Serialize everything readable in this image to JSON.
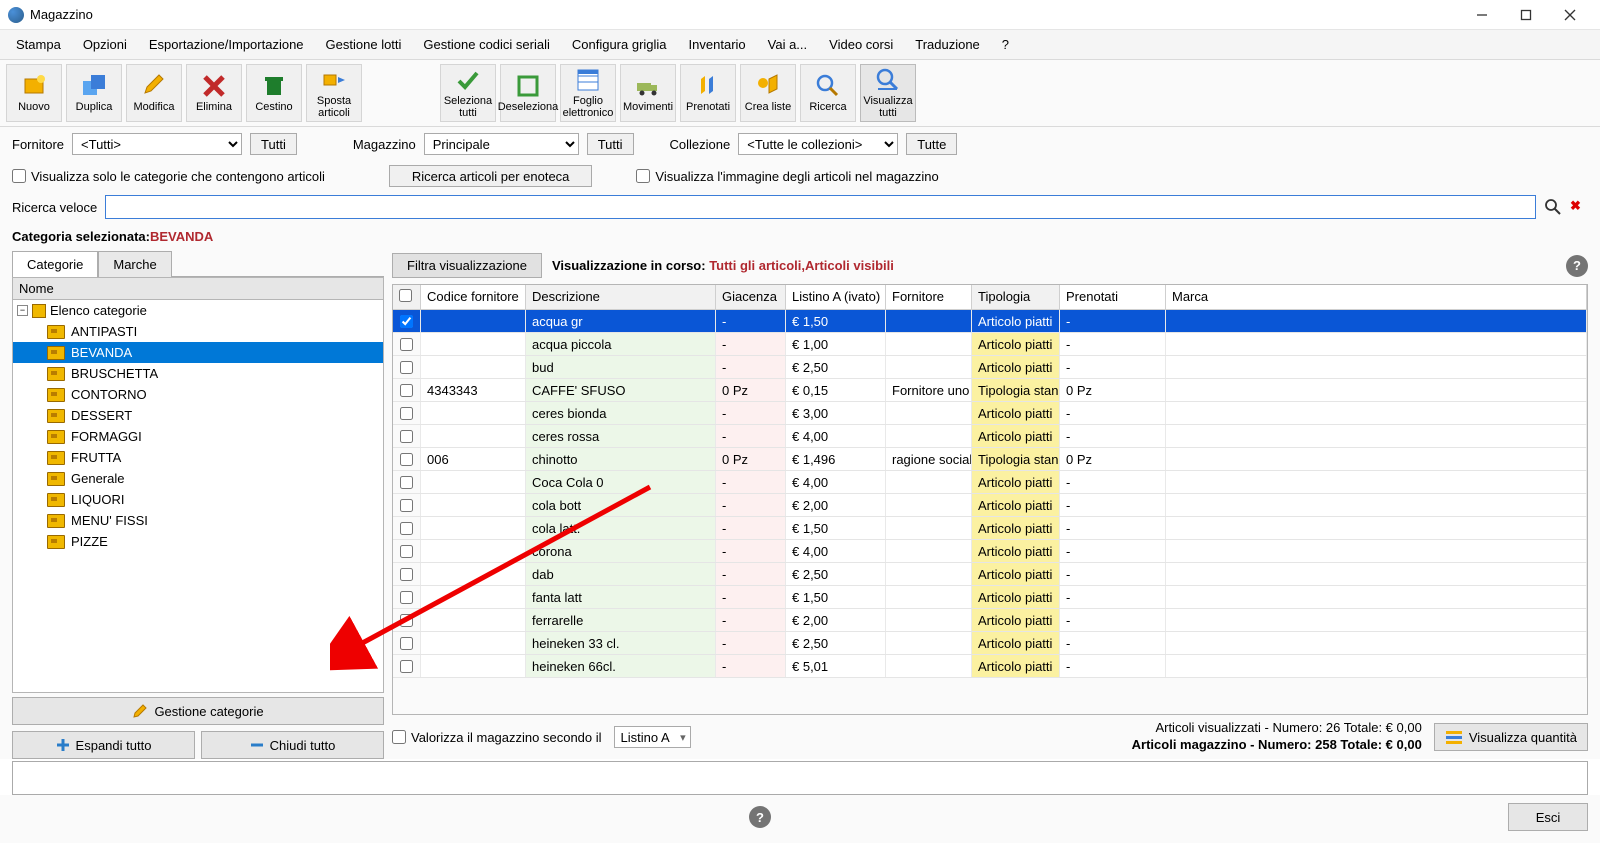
{
  "window": {
    "title": "Magazzino"
  },
  "menu": [
    "Stampa",
    "Opzioni",
    "Esportazione/Importazione",
    "Gestione lotti",
    "Gestione codici seriali",
    "Configura griglia",
    "Inventario",
    "Vai a...",
    "Video corsi",
    "Traduzione",
    "?"
  ],
  "toolbar": {
    "nuovo": "Nuovo",
    "duplica": "Duplica",
    "modifica": "Modifica",
    "elimina": "Elimina",
    "cestino": "Cestino",
    "sposta": "Sposta articoli",
    "sel_tutti": "Seleziona tutti",
    "deseleziona": "Deseleziona",
    "foglio": "Foglio elettronico",
    "movimenti": "Movimenti",
    "prenotati": "Prenotati",
    "crea_liste": "Crea liste",
    "ricerca": "Ricerca",
    "visualizza": "Visualizza tutti"
  },
  "filters": {
    "fornitore_lbl": "Fornitore",
    "fornitore_val": "<Tutti>",
    "tutti": "Tutti",
    "magazzino_lbl": "Magazzino",
    "magazzino_val": "Principale",
    "collezione_lbl": "Collezione",
    "collezione_val": "<Tutte le collezioni>",
    "tutte": "Tutte",
    "visualizza_solo": "Visualizza solo le categorie che contengono articoli",
    "ricerca_enoteca": "Ricerca articoli per enoteca",
    "visualizza_img": "Visualizza l'immagine degli articoli nel magazzino",
    "ricerca_veloce": "Ricerca veloce"
  },
  "category": {
    "sel_lbl": "Categoria selezionata: ",
    "sel_val": "BEVANDA",
    "tab_categorie": "Categorie",
    "tab_marche": "Marche",
    "nome": "Nome",
    "root": "Elenco categorie",
    "items": [
      "ANTIPASTI",
      "BEVANDA",
      "BRUSCHETTA",
      "CONTORNO",
      "DESSERT",
      "FORMAGGI",
      "FRUTTA",
      "Generale",
      "LIQUORI",
      "MENU' FISSI",
      "PIZZE"
    ],
    "gestione": "Gestione categorie",
    "espandi": "Espandi tutto",
    "chiudi": "Chiudi tutto"
  },
  "grid": {
    "filtra": "Filtra visualizzazione",
    "vis_corso": "Visualizzazione in corso: ",
    "vis_highlight": "Tutti gli articoli,Articoli visibili",
    "headers": {
      "codice": "Codice fornitore",
      "desc": "Descrizione",
      "giac": "Giacenza",
      "listino": "Listino A (ivato)",
      "forn": "Fornitore",
      "tipo": "Tipologia",
      "pren": "Prenotati",
      "marca": "Marca"
    },
    "rows": [
      {
        "sel": true,
        "cod": "",
        "desc": "acqua gr",
        "giac": "-",
        "list": "€ 1,50",
        "forn": "",
        "tipo": "Articolo piatti",
        "pren": "-"
      },
      {
        "cod": "",
        "desc": "acqua piccola",
        "giac": "-",
        "list": "€ 1,00",
        "forn": "",
        "tipo": "Articolo piatti",
        "pren": "-"
      },
      {
        "cod": "",
        "desc": "bud",
        "giac": "-",
        "list": "€ 2,50",
        "forn": "",
        "tipo": "Articolo piatti",
        "pren": "-"
      },
      {
        "cod": "4343343",
        "desc": "CAFFE' SFUSO",
        "giac": "0 Pz",
        "list": "€ 0,15",
        "forn": "Fornitore uno",
        "tipo": "Tipologia stan",
        "pren": "0 Pz"
      },
      {
        "cod": "",
        "desc": "ceres bionda",
        "giac": "-",
        "list": "€ 3,00",
        "forn": "",
        "tipo": "Articolo piatti",
        "pren": "-"
      },
      {
        "cod": "",
        "desc": "ceres rossa",
        "giac": "-",
        "list": "€ 4,00",
        "forn": "",
        "tipo": "Articolo piatti",
        "pren": "-"
      },
      {
        "cod": "006",
        "desc": "chinotto",
        "giac": "0 Pz",
        "list": "€ 1,496",
        "forn": "ragione sociale",
        "tipo": "Tipologia stan",
        "pren": "0 Pz"
      },
      {
        "cod": "",
        "desc": "Coca Cola 0",
        "giac": "-",
        "list": "€ 4,00",
        "forn": "",
        "tipo": "Articolo piatti",
        "pren": "-"
      },
      {
        "cod": "",
        "desc": "cola bott",
        "giac": "-",
        "list": "€ 2,00",
        "forn": "",
        "tipo": "Articolo piatti",
        "pren": "-"
      },
      {
        "cod": "",
        "desc": "cola latt.",
        "giac": "-",
        "list": "€ 1,50",
        "forn": "",
        "tipo": "Articolo piatti",
        "pren": "-"
      },
      {
        "cod": "",
        "desc": "corona",
        "giac": "-",
        "list": "€ 4,00",
        "forn": "",
        "tipo": "Articolo piatti",
        "pren": "-"
      },
      {
        "cod": "",
        "desc": "dab",
        "giac": "-",
        "list": "€ 2,50",
        "forn": "",
        "tipo": "Articolo piatti",
        "pren": "-"
      },
      {
        "cod": "",
        "desc": "fanta latt",
        "giac": "-",
        "list": "€ 1,50",
        "forn": "",
        "tipo": "Articolo piatti",
        "pren": "-"
      },
      {
        "cod": "",
        "desc": "ferrarelle",
        "giac": "-",
        "list": "€ 2,00",
        "forn": "",
        "tipo": "Articolo piatti",
        "pren": "-"
      },
      {
        "cod": "",
        "desc": "heineken 33 cl.",
        "giac": "-",
        "list": "€ 2,50",
        "forn": "",
        "tipo": "Articolo piatti",
        "pren": "-"
      },
      {
        "cod": "",
        "desc": "heineken 66cl.",
        "giac": "-",
        "list": "€ 5,01",
        "forn": "",
        "tipo": "Articolo piatti",
        "pren": "-"
      }
    ]
  },
  "footer": {
    "valorizza": "Valorizza il magazzino secondo il",
    "listino": "Listino A",
    "art_vis": "Articoli visualizzati - Numero: 26 Totale: € 0,00",
    "art_mag": "Articoli magazzino - Numero: 258 Totale: € 0,00",
    "vis_qty": "Visualizza quantità",
    "esci": "Esci"
  }
}
